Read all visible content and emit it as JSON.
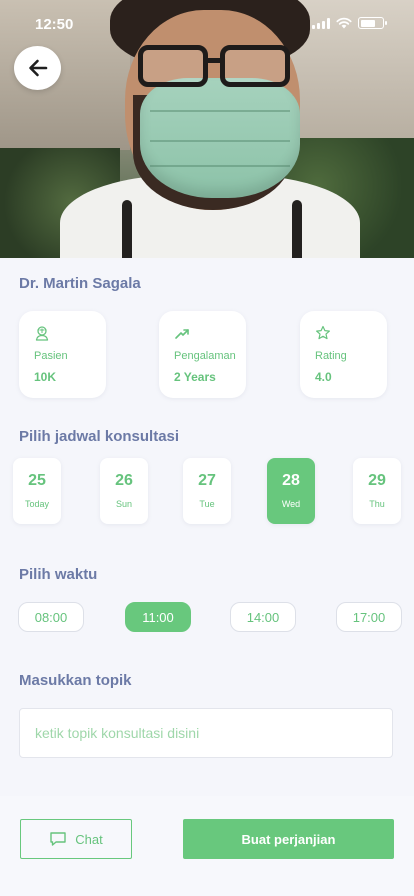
{
  "status_bar": {
    "time": "12:50"
  },
  "hero": {
    "image": "doctor-with-face-mask-photo"
  },
  "doctor": {
    "name": "Dr. Martin Sagala"
  },
  "stats": [
    {
      "icon": "patient-icon",
      "label": "Pasien",
      "value": "10K"
    },
    {
      "icon": "trending-up-icon",
      "label": "Pengalaman",
      "value": "2 Years"
    },
    {
      "icon": "star-icon",
      "label": "Rating",
      "value": "4.0"
    }
  ],
  "schedule": {
    "title": "Pilih jadwal konsultasi",
    "days": [
      {
        "date": "25",
        "day": "Today",
        "selected": false
      },
      {
        "date": "26",
        "day": "Sun",
        "selected": false
      },
      {
        "date": "27",
        "day": "Tue",
        "selected": false
      },
      {
        "date": "28",
        "day": "Wed",
        "selected": true
      },
      {
        "date": "29",
        "day": "Thu",
        "selected": false
      }
    ]
  },
  "time": {
    "title": "Pilih waktu",
    "slots": [
      {
        "label": "08:00",
        "selected": false
      },
      {
        "label": "11:00",
        "selected": true
      },
      {
        "label": "14:00",
        "selected": false
      },
      {
        "label": "17:00",
        "selected": false
      }
    ]
  },
  "topic": {
    "title": "Masukkan topik",
    "value": "",
    "placeholder": "ketik topik konsultasi disini"
  },
  "actions": {
    "chat_label": "Chat",
    "book_label": "Buat perjanjian"
  },
  "colors": {
    "accent": "#68c87d",
    "heading": "#6c7aa6",
    "background": "#f5f6fb"
  }
}
